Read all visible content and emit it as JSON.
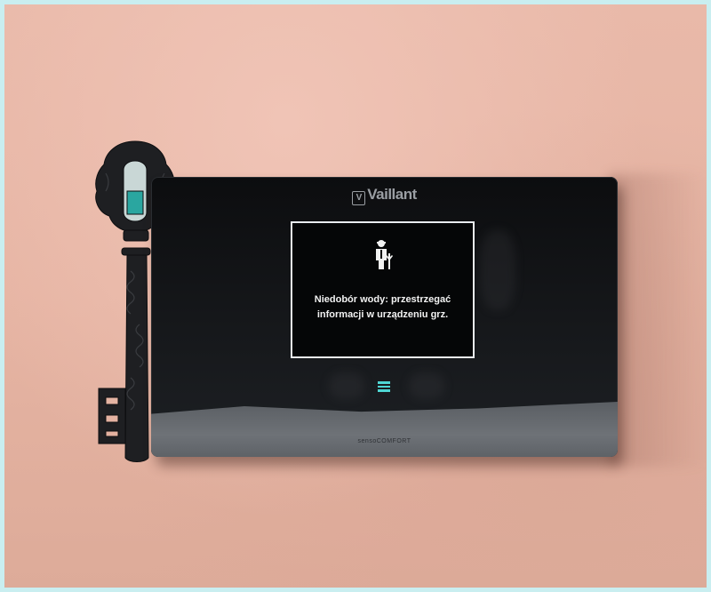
{
  "device": {
    "brand": "Vaillant",
    "brand_mark": "V",
    "model": "sensoCOMFORT"
  },
  "screen": {
    "icon": "service-technician-icon",
    "message": "Niedobór wody: przestrzegać\ninformacji w urządzeniu grz."
  },
  "controls": {
    "menu_icon": "hamburger-menu-icon"
  },
  "colors": {
    "wall": "#e6b4a3",
    "device_body": "#121417",
    "screen_text": "#f2f2f2",
    "menu_accent": "#4fd6d4",
    "frame_border": "#c9eef0"
  }
}
